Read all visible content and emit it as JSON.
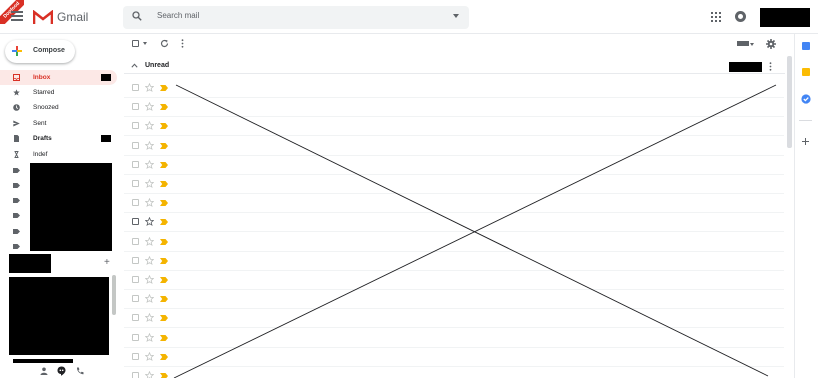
{
  "header": {
    "badge": "Dogfood",
    "brand": "Gmail",
    "search_placeholder": "Search mail"
  },
  "compose": {
    "label": "Compose"
  },
  "sidebar": {
    "items": [
      {
        "label": "Inbox",
        "icon": "inbox-icon",
        "active": true,
        "bold": true
      },
      {
        "label": "Starred",
        "icon": "star-icon"
      },
      {
        "label": "Snoozed",
        "icon": "clock-icon"
      },
      {
        "label": "Sent",
        "icon": "send-icon"
      },
      {
        "label": "Drafts",
        "icon": "draft-icon",
        "bold": true
      },
      {
        "label": "Indef",
        "icon": "hourglass-icon"
      }
    ],
    "label_icons": 6,
    "add_label": "+"
  },
  "main": {
    "section_title": "Unread",
    "row_count": 16
  },
  "colors": {
    "accent_red": "#d93025",
    "important_yellow": "#f4b400",
    "side_blue": "#4285f4",
    "side_yellow": "#fbbc04"
  }
}
